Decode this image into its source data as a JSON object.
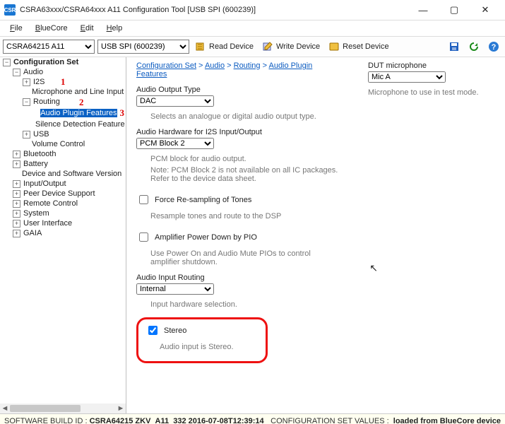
{
  "window": {
    "title": "CSRA63xxx/CSRA64xxx A11 Configuration Tool [USB SPI (600239)]"
  },
  "menu": {
    "file": "File",
    "bluecore": "BlueCore",
    "edit": "Edit",
    "help": "Help"
  },
  "toolbar": {
    "chip": "CSRA64215 A11",
    "connection": "USB SPI (600239)",
    "read": "Read Device",
    "write": "Write Device",
    "reset": "Reset Device"
  },
  "tree": {
    "root": "Configuration Set",
    "audio": "Audio",
    "i2s": "I2S",
    "mic": "Microphone and Line Input",
    "routing": "Routing",
    "apf": "Audio Plugin Features",
    "sdf": "Silence Detection Feature",
    "usb": "USB",
    "vol": "Volume Control",
    "bt": "Bluetooth",
    "batt": "Battery",
    "dsv": "Device and Software Version",
    "io": "Input/Output",
    "pds": "Peer Device Support",
    "rc": "Remote Control",
    "sys": "System",
    "ui": "User Interface",
    "gaia": "GAIA"
  },
  "crumb": {
    "a": "Configuration Set",
    "b": "Audio",
    "c": "Routing",
    "d": "Audio Plugin Features"
  },
  "form": {
    "aot_label": "Audio Output Type",
    "aot_value": "DAC",
    "aot_hint": "Selects an analogue or digital audio output type.",
    "ahw_label": "Audio Hardware for I2S Input/Output",
    "ahw_value": "PCM Block 2",
    "ahw_hint": "PCM block for audio output.",
    "ahw_note": "Note: PCM Block 2 is not available on all IC packages. Refer to the device data sheet.",
    "frs_label": "Force Re-sampling of Tones",
    "frs_hint": "Resample tones and route to the DSP",
    "apd_label": "Amplifier Power Down by PIO",
    "apd_hint": "Use Power On and Audio Mute PIOs to control amplifier shutdown.",
    "air_label": "Audio Input Routing",
    "air_value": "Internal",
    "air_hint": "Input hardware selection.",
    "stereo_label": "Stereo",
    "stereo_hint": "Audio input is Stereo."
  },
  "right": {
    "dut_label": "DUT microphone",
    "dut_value": "Mic A",
    "dut_hint": "Microphone to use in test mode."
  },
  "status": {
    "left_label": "SOFTWARE BUILD ID :",
    "left_value": "CSRA64215 ZKV_A11_332 2016-07-08T12:39:14",
    "right_label": "CONFIGURATION SET VALUES :",
    "right_value": "loaded from BlueCore device"
  }
}
